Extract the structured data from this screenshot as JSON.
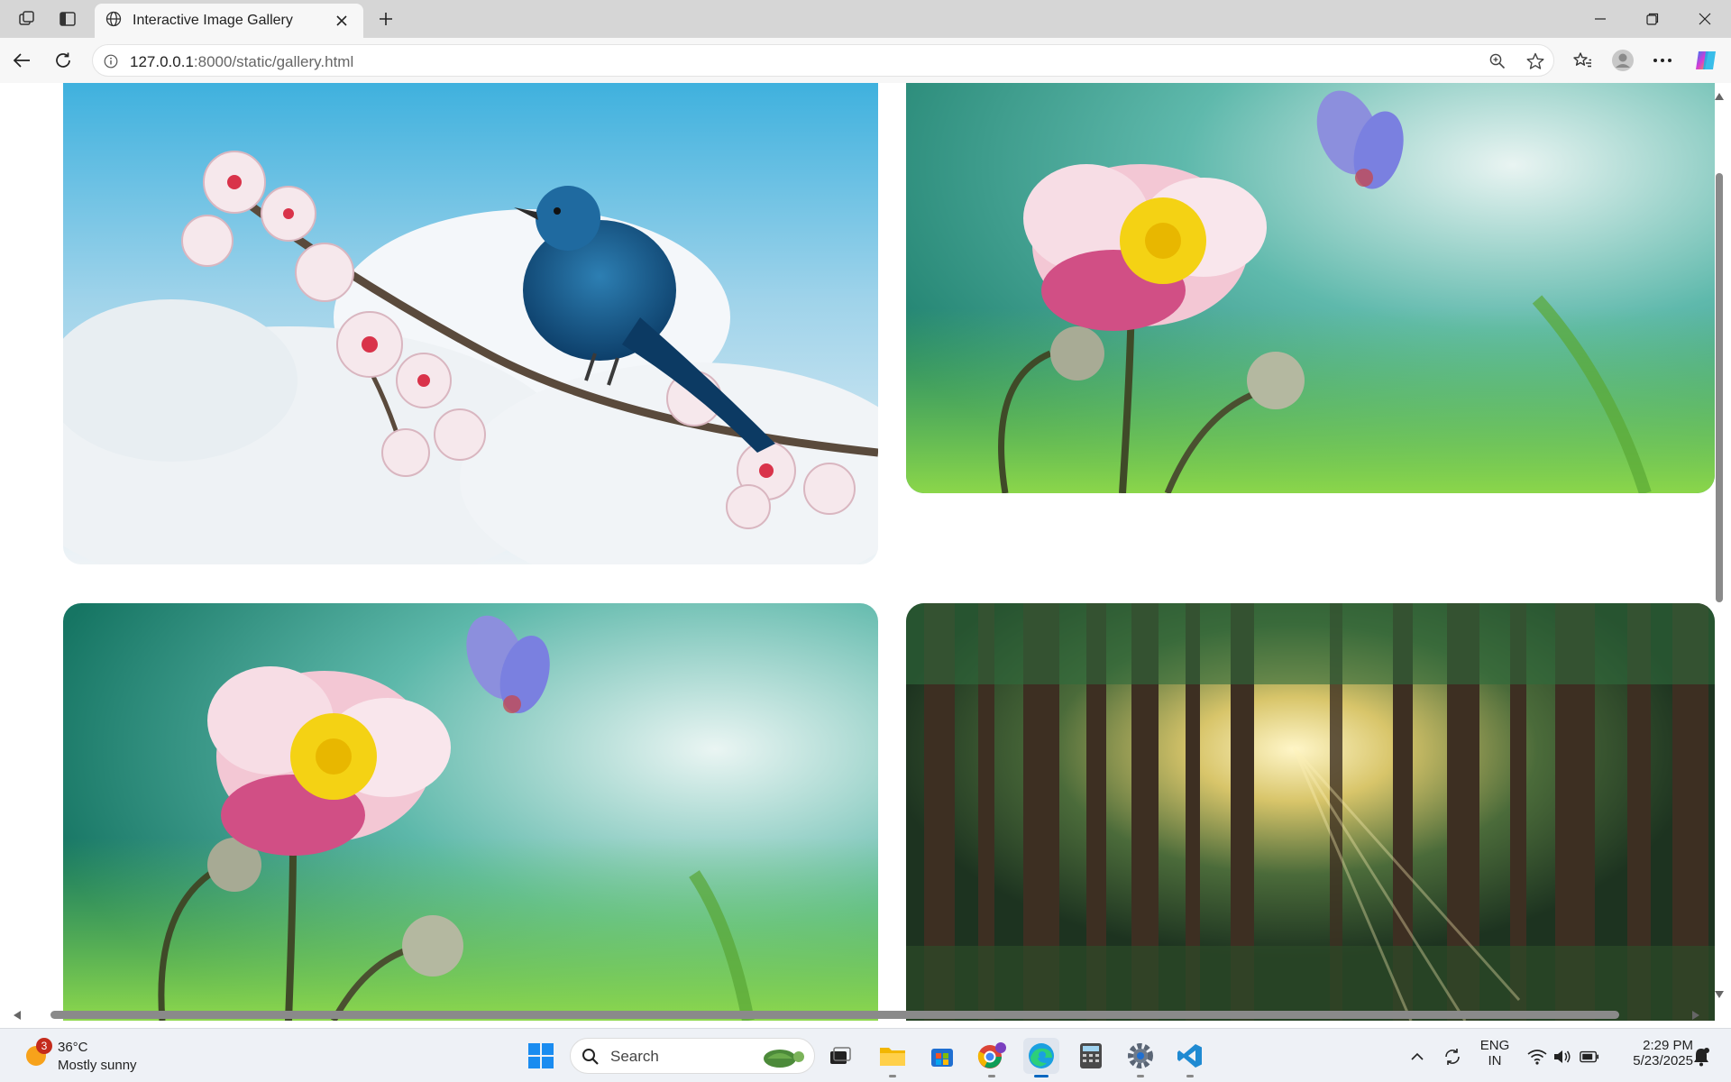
{
  "browser": {
    "tab": {
      "title": "Interactive Image Gallery",
      "favicon": "globe-icon"
    },
    "address": {
      "host": "127.0.0.1",
      "path": ":8000/static/gallery.html"
    }
  },
  "gallery": {
    "images": [
      {
        "subject": "bluebird-on-blossom-branch"
      },
      {
        "subject": "pink-anemone-with-butterfly"
      },
      {
        "subject": "pink-anemone-with-butterfly"
      },
      {
        "subject": "sunlit-forest"
      }
    ]
  },
  "taskbar": {
    "weather": {
      "temp": "36°C",
      "condition": "Mostly sunny",
      "badge": "3"
    },
    "search_label": "Search",
    "language": {
      "line1": "ENG",
      "line2": "IN"
    },
    "clock": {
      "time": "2:29 PM",
      "date": "5/23/2025"
    }
  },
  "colors": {
    "accent": "#0067c0",
    "tab_bar": "#d6d6d6",
    "toolbar": "#f7f7f7",
    "taskbar": "#eef1f6"
  }
}
